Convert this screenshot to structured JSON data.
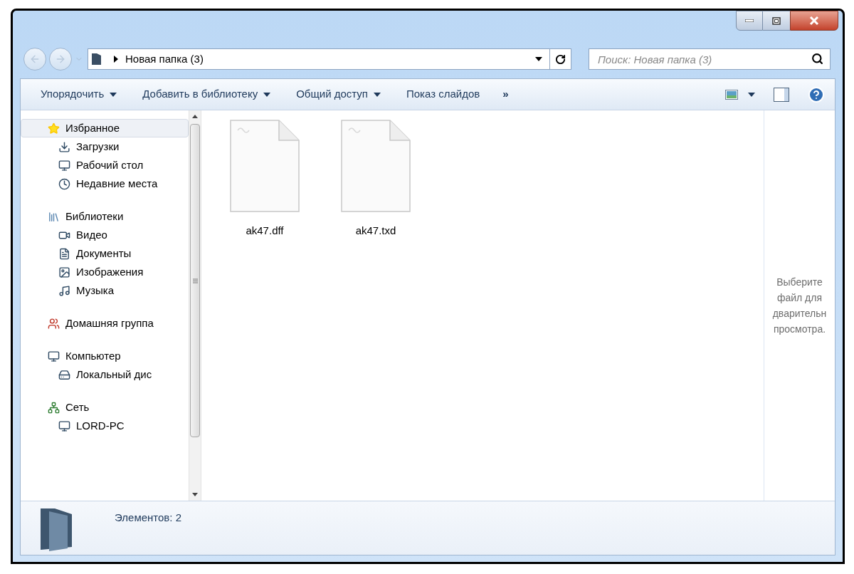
{
  "address": {
    "path": "Новая папка (3)"
  },
  "search": {
    "placeholder": "Поиск: Новая папка (3)"
  },
  "toolbar": {
    "items": [
      {
        "label": "Упорядочить",
        "dropdown": true
      },
      {
        "label": "Добавить в библиотеку",
        "dropdown": true
      },
      {
        "label": "Общий доступ",
        "dropdown": true
      },
      {
        "label": "Показ слайдов",
        "dropdown": false
      }
    ],
    "overflow": "»"
  },
  "nav": {
    "groups": [
      {
        "label": "Избранное",
        "kind": "star",
        "selected": true,
        "children": [
          {
            "label": "Загрузки",
            "kind": "downloads",
            "selected": false
          },
          {
            "label": "Рабочий стол",
            "kind": "desktop",
            "selected": false
          },
          {
            "label": "Недавние места",
            "kind": "recent",
            "selected": false
          }
        ]
      },
      {
        "label": "Библиотеки",
        "kind": "libraries",
        "selected": false,
        "children": [
          {
            "label": "Видео",
            "kind": "video",
            "selected": false
          },
          {
            "label": "Документы",
            "kind": "documents",
            "selected": false
          },
          {
            "label": "Изображения",
            "kind": "pictures",
            "selected": false
          },
          {
            "label": "Музыка",
            "kind": "music",
            "selected": false
          }
        ]
      },
      {
        "label": "Домашняя группа",
        "kind": "homegroup",
        "selected": false
      },
      {
        "label": "Компьютер",
        "kind": "computer",
        "selected": false,
        "children": [
          {
            "label": "Локальный дис",
            "kind": "disk",
            "selected": false
          }
        ]
      },
      {
        "label": "Сеть",
        "kind": "network",
        "selected": false,
        "children": [
          {
            "label": "LORD-PC",
            "kind": "pc",
            "selected": false
          }
        ]
      }
    ]
  },
  "files": [
    {
      "name": "ak47.dff"
    },
    {
      "name": "ak47.txd"
    }
  ],
  "preview": {
    "message": "Выберите\nфайл для\nдварительн\nпросмотра."
  },
  "status": {
    "text": "Элементов: 2"
  }
}
